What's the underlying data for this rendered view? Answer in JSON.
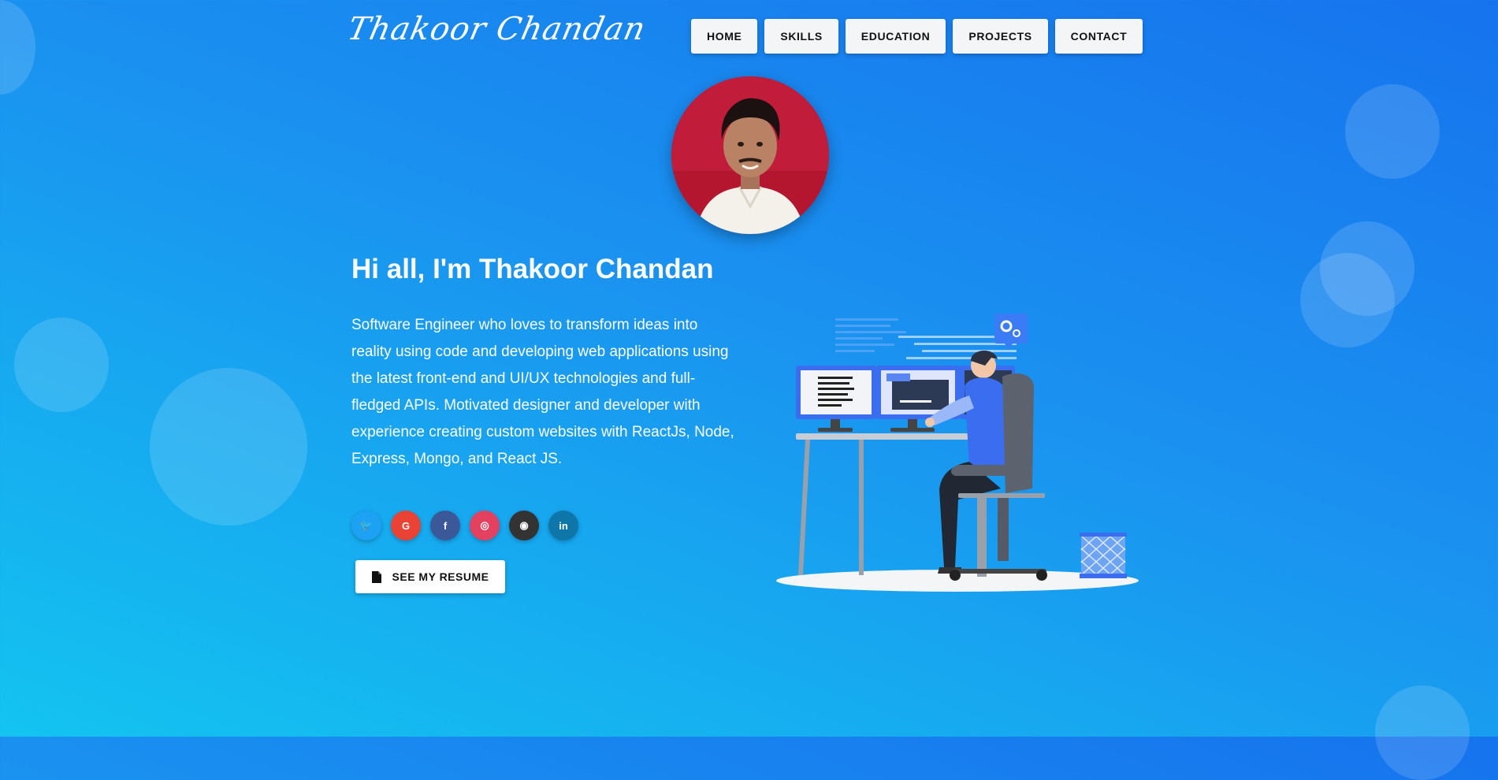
{
  "logo": {
    "text": "Thakoor Chandan"
  },
  "nav": {
    "items": [
      {
        "label": "HOME"
      },
      {
        "label": "SKILLS"
      },
      {
        "label": "EDUCATION"
      },
      {
        "label": "PROJECTS"
      },
      {
        "label": "CONTACT"
      }
    ]
  },
  "hero": {
    "greeting": "Hi all, I'm Thakoor Chandan",
    "about": "Software Engineer who loves to transform ideas into reality using code and developing web applications using the latest front-end and UI/UX technologies and full-fledged APIs. Motivated designer and developer with experience creating custom websites with ReactJs, Node, Express, Mongo, and React JS.",
    "resume_label": "SEE MY RESUME"
  },
  "socials": [
    {
      "name": "twitter-icon",
      "glyph": "🐦",
      "color": "#1da1f2"
    },
    {
      "name": "google-icon",
      "glyph": "G",
      "color": "#ea4335"
    },
    {
      "name": "facebook-icon",
      "glyph": "f",
      "color": "#3b5998"
    },
    {
      "name": "instagram-icon",
      "glyph": "◎",
      "color": "#e4405f"
    },
    {
      "name": "github-icon",
      "glyph": "◉",
      "color": "#333333"
    },
    {
      "name": "linkedin-icon",
      "glyph": "in",
      "color": "#0e76a8"
    }
  ],
  "colors": {
    "background_start": "#1673ee",
    "background_end": "#13c4f0",
    "button_bg": "#f4f5f7",
    "avatar_bg": "#b4162f"
  }
}
